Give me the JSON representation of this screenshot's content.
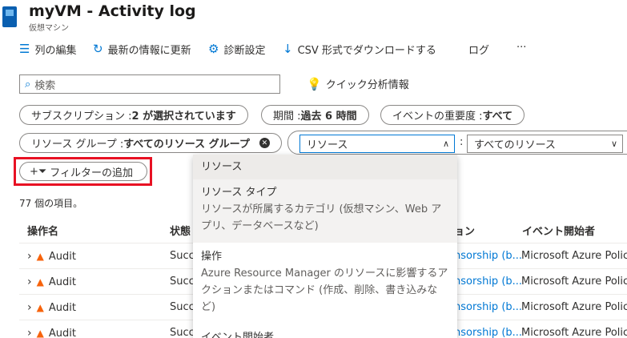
{
  "header": {
    "title": "myVM - Activity log",
    "subtitle": "仮想マシン"
  },
  "toolbar": {
    "edit_columns": "列の編集",
    "refresh": "最新の情報に更新",
    "diagnostics": "診断設定",
    "download": "CSV 形式でダウンロードする",
    "logs": "ログ",
    "more": "···"
  },
  "search": {
    "placeholder": "検索"
  },
  "insights": "クイック分析情報",
  "filters": {
    "subscription": {
      "label": "サブスクリプション : ",
      "value": "2 が選択されています"
    },
    "timespan": {
      "label": "期間 : ",
      "value": "過去 6 時間"
    },
    "severity": {
      "label": "イベントの重要度 : ",
      "value": "すべて"
    },
    "resource_group": {
      "label": "リソース グループ : ",
      "value": "すべてのリソース グループ"
    },
    "resource_select": "リソース",
    "resource_colon": ":",
    "resource_value": "すべてのリソース",
    "add_filter": "フィルターの追加"
  },
  "item_count": "77 個の項目。",
  "table": {
    "columns": [
      "操作名",
      "状態",
      "ョン",
      "イベント開始者"
    ],
    "rows": [
      {
        "operation": "Audit",
        "status": "Succe",
        "scope": "nsorship (b...",
        "initiator": "Microsoft Azure Policy"
      },
      {
        "operation": "Audit",
        "status": "Succe",
        "scope": "nsorship (b...",
        "initiator": "Microsoft Azure Policy"
      },
      {
        "operation": "Audit",
        "status": "Succe",
        "scope": "nsorship (b...",
        "initiator": "Microsoft Azure Policy"
      },
      {
        "operation": "Audit",
        "status": "Succe",
        "scope": "nsorship (b...",
        "initiator": "Microsoft Azure Policy"
      }
    ]
  },
  "menu": {
    "items": [
      {
        "label": "リソース",
        "desc": ""
      },
      {
        "label": "リソース タイプ",
        "desc1": "リソースが所属するカテゴリ (仮想マシン、Web ア",
        "desc2": "プリ、データベースなど)"
      },
      {
        "label": "操作",
        "desc1": "Azure Resource Manager のリソースに影響するア",
        "desc2": "クションまたはコマンド (作成、削除、書き込みな",
        "desc3": "ど)"
      },
      {
        "label": "イベント開始者"
      }
    ]
  },
  "colors": {
    "accent": "#0078d4",
    "highlight": "#e81123",
    "warning": "#f7630c"
  }
}
